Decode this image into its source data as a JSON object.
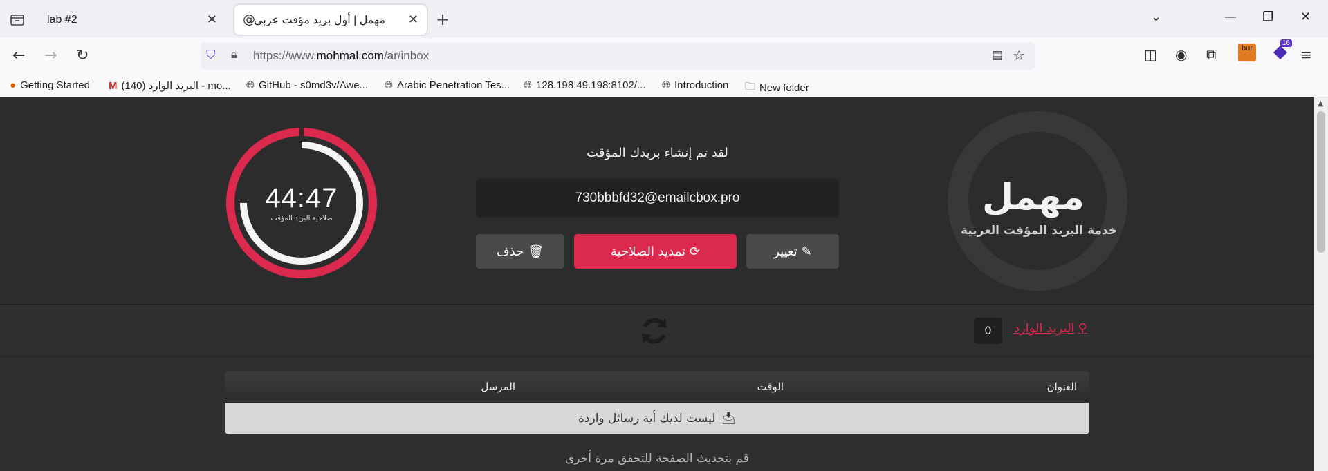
{
  "browser": {
    "tabs": [
      {
        "title": "lab #2",
        "active": false
      },
      {
        "title": "مهمل | أول بريد مؤقت عربي",
        "active": true,
        "favicon": "@"
      }
    ],
    "url_prefix": "https://www.",
    "url_domain": "mohmal.com",
    "url_path": "/ar/inbox",
    "extension_badge": "16",
    "burp_label": "bur",
    "bookmarks": [
      {
        "label": "Getting Started",
        "icon": "firefox-icon"
      },
      {
        "label": "البريد الوارد (140) - mo...",
        "icon": "gmail-icon"
      },
      {
        "label": "GitHub - s0md3v/Awe...",
        "icon": "globe-icon"
      },
      {
        "label": "Arabic Penetration Tes...",
        "icon": "globe-icon"
      },
      {
        "label": "128.198.49.198:8102/...",
        "icon": "globe-icon"
      },
      {
        "label": "Introduction",
        "icon": "globe-icon"
      },
      {
        "label": "New folder",
        "icon": "folder-icon"
      }
    ]
  },
  "site": {
    "logo": "مهمل",
    "tagline": "خدمة البريد المؤقت العربية",
    "created_message": "لقد تم إنشاء بريدك المؤقت",
    "email": "730bbbfd32@emailcbox.pro",
    "buttons": {
      "change": "تغيير",
      "extend": "تمديد الصلاحية",
      "delete": "حذف"
    },
    "timer": {
      "value": "44:47",
      "label": "صلاحية البريد المؤقت",
      "remaining_fraction": 0.75
    },
    "inbox": {
      "link_label": "البريد الوارد",
      "count": "0"
    },
    "table": {
      "col_subject": "العنوان",
      "col_time": "الوقت",
      "col_sender": "المرسل",
      "empty_message": "ليست لديك أية رسائل واردة"
    },
    "hint": "قم بتحديث الصفحة للتحقق مرة أخرى"
  },
  "colors": {
    "accent": "#dc2a4e",
    "background": "#2f2f2f"
  }
}
